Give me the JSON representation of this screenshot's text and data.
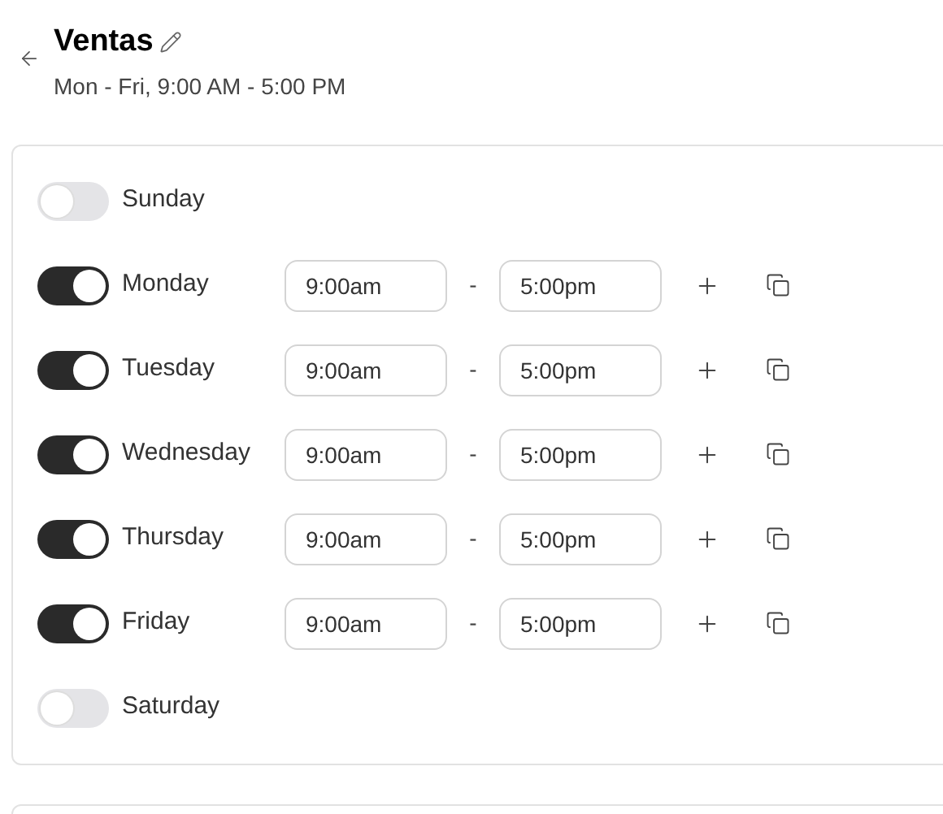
{
  "header": {
    "title": "Ventas",
    "subtitle": "Mon - Fri, 9:00 AM - 5:00 PM"
  },
  "days": [
    {
      "name": "Sunday",
      "on": false
    },
    {
      "name": "Monday",
      "on": true,
      "start": "9:00am",
      "separator": "-",
      "end": "5:00pm"
    },
    {
      "name": "Tuesday",
      "on": true,
      "start": "9:00am",
      "separator": "-",
      "end": "5:00pm"
    },
    {
      "name": "Wednesday",
      "on": true,
      "start": "9:00am",
      "separator": "-",
      "end": "5:00pm"
    },
    {
      "name": "Thursday",
      "on": true,
      "start": "9:00am",
      "separator": "-",
      "end": "5:00pm"
    },
    {
      "name": "Friday",
      "on": true,
      "start": "9:00am",
      "separator": "-",
      "end": "5:00pm"
    },
    {
      "name": "Saturday",
      "on": false
    }
  ]
}
